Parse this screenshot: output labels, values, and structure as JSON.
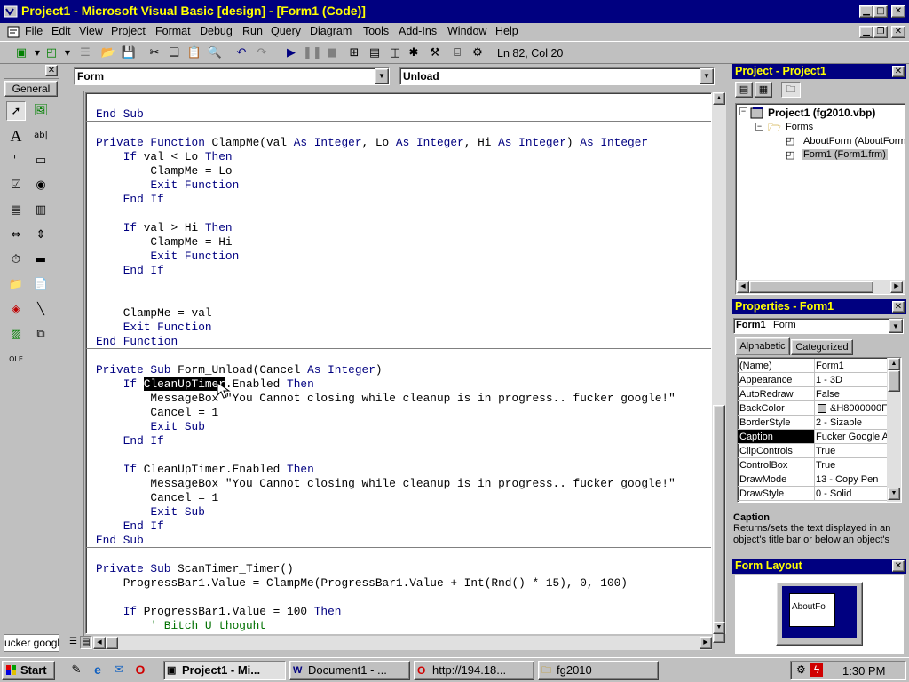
{
  "window": {
    "title": "Project1 - Microsoft Visual Basic [design] - [Form1 (Code)]"
  },
  "menu": [
    "File",
    "Edit",
    "View",
    "Project",
    "Format",
    "Debug",
    "Run",
    "Query",
    "Diagram",
    "Tools",
    "Add-Ins",
    "Window",
    "Help"
  ],
  "toolbar": {
    "position": "Ln 82, Col 20"
  },
  "toolbox": {
    "title": "General",
    "bottom_text": "ucker google"
  },
  "code_window": {
    "object_combo": "Form",
    "procedure_combo": "Unload",
    "lines": [
      "End Sub",
      "",
      "Private Function ClampMe(val As Integer, Lo As Integer, Hi As Integer) As Integer",
      "    If val < Lo Then",
      "        ClampMe = Lo",
      "        Exit Function",
      "    End If",
      "",
      "    If val > Hi Then",
      "        ClampMe = Hi",
      "        Exit Function",
      "    End If",
      "",
      "",
      "    ClampMe = val",
      "    Exit Function",
      "End Function",
      "",
      "Private Sub Form_Unload(Cancel As Integer)",
      "    If CleanUpTimer.Enabled Then",
      "        MessageBox \"You Cannot closing while cleanup is in progress.. fucker google!\"",
      "        Cancel = 1",
      "        Exit Sub",
      "    End If",
      "",
      "    If CleanUpTimer.Enabled Then",
      "        MessageBox \"You Cannot closing while cleanup is in progress.. fucker google!\"",
      "        Cancel = 1",
      "        Exit Sub",
      "    End If",
      "End Sub",
      "",
      "Private Sub ScanTimer_Timer()",
      "    ProgressBar1.Value = ClampMe(ProgressBar1.Value + Int(Rnd() * 15), 0, 100)",
      "",
      "    If ProgressBar1.Value = 100 Then",
      "        ' Bitch U thoguht"
    ],
    "selected_text": "CleanUpTimer"
  },
  "project_explorer": {
    "title": "Project - Project1",
    "root": "Project1 (fg2010.vbp)",
    "folder": "Forms",
    "items": [
      "AboutForm (AboutForm",
      "Form1 (Form1.frm)"
    ]
  },
  "properties": {
    "title": "Properties - Form1",
    "object_name": "Form1",
    "object_type": "Form",
    "tabs": [
      "Alphabetic",
      "Categorized"
    ],
    "rows": [
      {
        "name": "(Name)",
        "value": "Form1"
      },
      {
        "name": "Appearance",
        "value": "1 - 3D"
      },
      {
        "name": "AutoRedraw",
        "value": "False"
      },
      {
        "name": "BackColor",
        "value": "&H8000000F"
      },
      {
        "name": "BorderStyle",
        "value": "2 - Sizable"
      },
      {
        "name": "Caption",
        "value": "Fucker Google A"
      },
      {
        "name": "ClipControls",
        "value": "True"
      },
      {
        "name": "ControlBox",
        "value": "True"
      },
      {
        "name": "DrawMode",
        "value": "13 - Copy Pen"
      },
      {
        "name": "DrawStyle",
        "value": "0 - Solid"
      }
    ],
    "desc_title": "Caption",
    "desc_text": "Returns/sets the text displayed in an object's title bar or below an object's"
  },
  "form_layout": {
    "title": "Form Layout",
    "form_label": "AboutFo"
  },
  "taskbar": {
    "start": "Start",
    "tasks": [
      "Project1 - Mi...",
      "Document1 - ...",
      "http://194.18...",
      "fg2010"
    ],
    "clock": "1:30 PM"
  },
  "colors": {
    "title_bg": "#000080",
    "title_fg": "#ffff00",
    "keyword": "#000080",
    "comment": "#007000",
    "face": "#c0c0c0"
  }
}
